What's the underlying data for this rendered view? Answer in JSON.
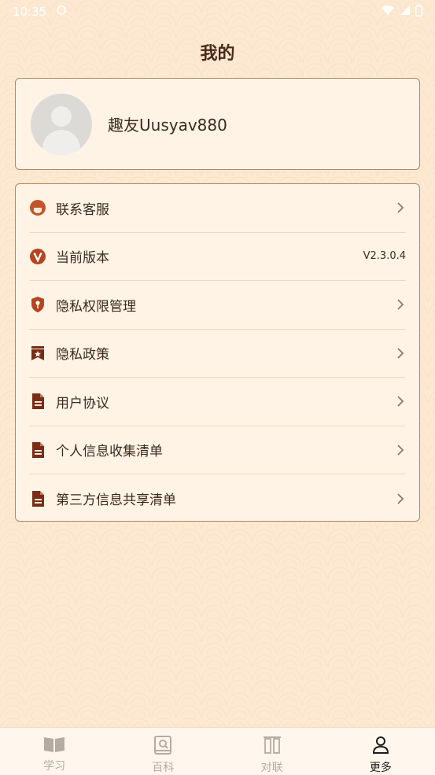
{
  "status_bar": {
    "time": "10:35"
  },
  "page": {
    "title": "我的"
  },
  "profile": {
    "username": "趣友Uusyav880"
  },
  "menu": {
    "items": [
      {
        "label": "联系客服",
        "icon": "customer-service-icon"
      },
      {
        "label": "当前版本",
        "icon": "version-icon",
        "value": "V2.3.0.4"
      },
      {
        "label": "隐私权限管理",
        "icon": "shield-key-icon"
      },
      {
        "label": "隐私政策",
        "icon": "bookmark-star-icon"
      },
      {
        "label": "用户协议",
        "icon": "document-icon"
      },
      {
        "label": "个人信息收集清单",
        "icon": "document-icon"
      },
      {
        "label": "第三方信息共享清单",
        "icon": "document-icon"
      }
    ]
  },
  "bottom_nav": {
    "items": [
      {
        "label": "学习",
        "icon": "book-open-icon"
      },
      {
        "label": "百科",
        "icon": "encyclopedia-icon"
      },
      {
        "label": "对联",
        "icon": "couplet-icon"
      },
      {
        "label": "更多",
        "icon": "person-icon",
        "active": true
      }
    ]
  },
  "colors": {
    "accent": "#b5441f",
    "border": "#b08760",
    "background": "#fde8d2"
  }
}
